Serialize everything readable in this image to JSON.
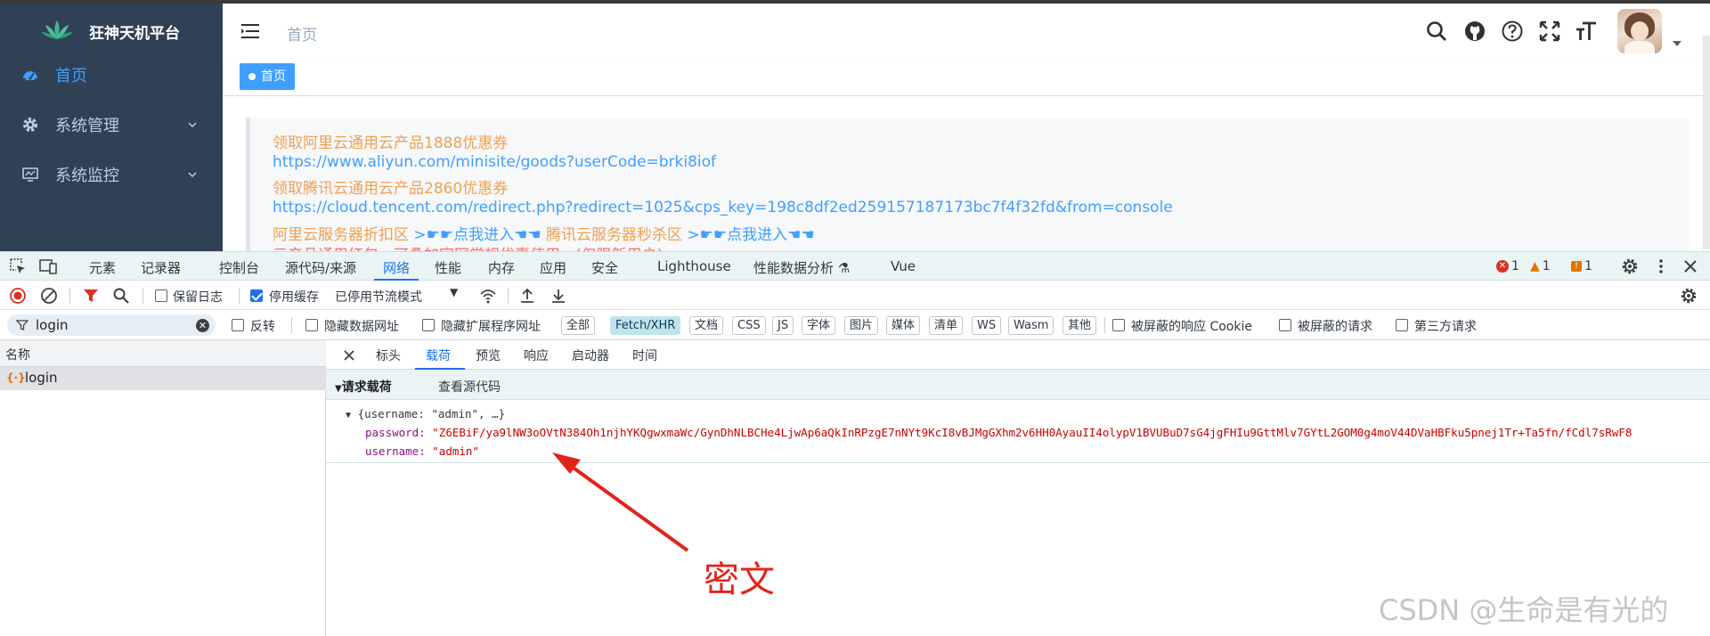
{
  "app": {
    "brand": "狂神天机平台",
    "menu": [
      {
        "label": "首页",
        "icon": "dashboard-icon",
        "active": true
      },
      {
        "label": "系统管理",
        "icon": "gear-icon",
        "active": false
      },
      {
        "label": "系统监控",
        "icon": "monitor-icon",
        "active": false
      }
    ],
    "breadcrumb": "首页",
    "active_tag": "首页",
    "header_icons": [
      "search-icon",
      "github-icon",
      "help-icon",
      "fullscreen-icon",
      "font-size-icon"
    ],
    "notice_lines": [
      {
        "text": "领取阿里云通用云产品1888优惠券",
        "color": "orange"
      },
      {
        "text": "https://www.aliyun.com/minisite/goods?userCode=brki8iof",
        "color": "blue"
      },
      {
        "text": "领取腾讯云通用云产品2860优惠券",
        "color": "orange"
      },
      {
        "text": "https://cloud.tencent.com/redirect.php?redirect=1025&cps_key=198c8df2ed259157187173bc7f4f32fd&from=console",
        "color": "blue"
      }
    ],
    "promo": {
      "a": "阿里云服务器折扣区",
      "a_link": ">☛☛点我进入☚☚",
      "b": "腾讯云服务器秒杀区",
      "b_link": ">☛☛点我进入☚☚"
    },
    "notice_cut": "云产品通用红包，可叠加官网常规优惠使用。(仅限新用户)"
  },
  "devtools": {
    "tabs": [
      "元素",
      "记录器",
      "控制台",
      "源代码/来源",
      "网络",
      "性能",
      "内存",
      "应用",
      "安全",
      "Lighthouse",
      "性能数据分析",
      "Vue"
    ],
    "active_tab": "网络",
    "errors": "1",
    "warnings": "1",
    "issues": "1",
    "toolbar": {
      "preserve_log": "保留日志",
      "disable_cache": "停用缓存",
      "throttle": "已停用节流模式"
    },
    "filter": {
      "value": "login",
      "invert": "反转",
      "hide_data_urls": "隐藏数据网址",
      "hide_ext_urls": "隐藏扩展程序网址",
      "types": [
        "全部",
        "Fetch/XHR",
        "文档",
        "CSS",
        "JS",
        "字体",
        "图片",
        "媒体",
        "清单",
        "WS",
        "Wasm",
        "其他"
      ],
      "selected_type": "Fetch/XHR",
      "blocked_cookies": "被屏蔽的响应 Cookie",
      "blocked_requests": "被屏蔽的请求",
      "third_party": "第三方请求"
    },
    "list_header": "名称",
    "request_name": "login",
    "detail_tabs": [
      "标头",
      "载荷",
      "预览",
      "响应",
      "启动器",
      "时间"
    ],
    "active_detail_tab": "载荷",
    "payload_section": "请求载荷",
    "view_source": "查看源代码",
    "payload_summary": "{username: \"admin\", …}",
    "payload": {
      "password_key": "password: ",
      "password_value": "\"Z6EBiF/ya9lNW3oOVtN384Oh1njhYKQgwxmaWc/GynDhNLBCHe4LjwAp6aQkInRPzgE7nNYt9KcI8vBJMgGXhm2v6HH0AyauII4olypV1BVUBuD7sG4jgFHIu9GttMlv7GYtL2GOM0g4moV44DVaHBFku5pnej1Tr+Ta5fn/fCdl7sRwF8",
      "username_key": "username: ",
      "username_value": "\"admin\""
    }
  },
  "annotation": "密文",
  "watermark": "CSDN @生命是有光的",
  "colors": {
    "sidebar": "#304156",
    "accent": "#409eff",
    "annotation": "#e0241b"
  }
}
